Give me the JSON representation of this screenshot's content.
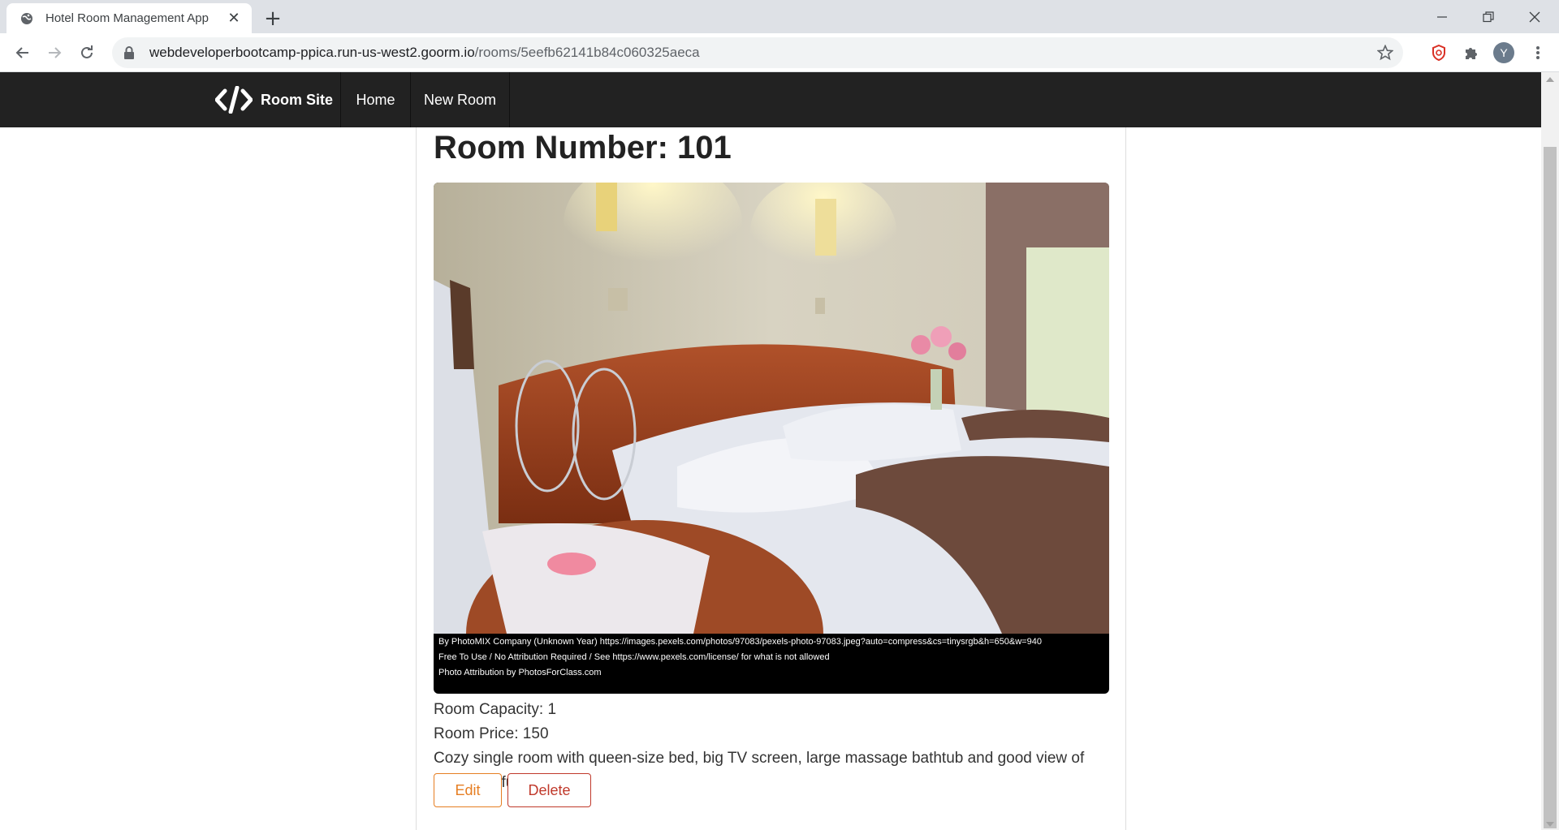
{
  "browser": {
    "tab_title": "Hotel Room Management App",
    "url_host": "webdeveloperbootcamp-ppica.run-us-west2.goorm.io",
    "url_path": "/rooms/5eefb62141b84c060325aeca",
    "profile_initial": "Y"
  },
  "nav": {
    "brand": "Room Site",
    "links": [
      "Home",
      "New Room"
    ]
  },
  "room": {
    "title": "Room Number: 101",
    "photo_credit_line1": "By PhotoMIX Company (Unknown Year) https://images.pexels.com/photos/97083/pexels-photo-97083.jpeg?auto=compress&cs=tinysrgb&h=650&w=940",
    "photo_credit_line2": "Free To Use / No Attribution Required / See https://www.pexels.com/license/ for what is not allowed",
    "photo_credit_line3": "Photo Attribution by PhotosForClass.com",
    "capacity": "Room Capacity: 1",
    "price": "Room Price: 150",
    "description": "Cozy single room with queen-size bed, big TV screen, large massage bathtub and good view of the beautiful garden.",
    "edit_label": "Edit",
    "delete_label": "Delete"
  },
  "colors": {
    "navbar": "#222222",
    "edit": "#e67e22",
    "delete": "#c0392b"
  }
}
